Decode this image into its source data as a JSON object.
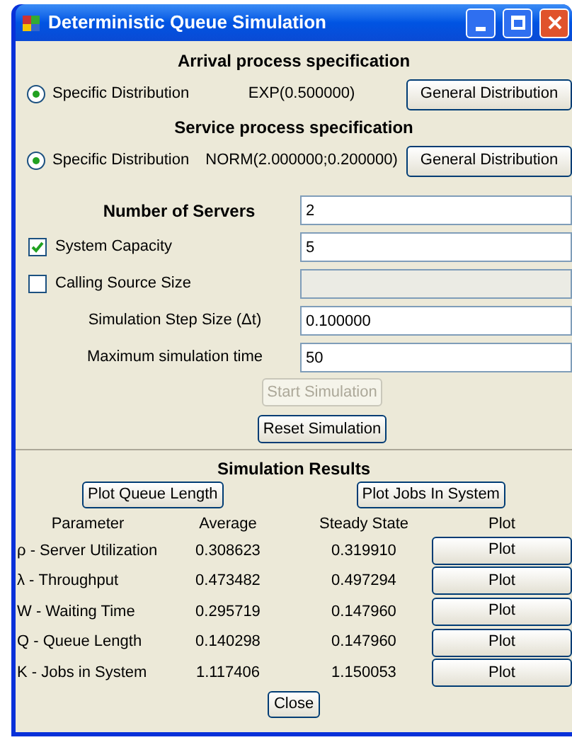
{
  "window": {
    "title": "Deterministic Queue Simulation"
  },
  "processes": [
    {
      "heading": "Arrival process specification",
      "radio": {
        "label": "Specific Distribution",
        "selected": true
      },
      "value": "EXP(0.500000)",
      "button": "General Distribution"
    },
    {
      "heading": "Service process specification",
      "radio": {
        "label": "Specific Distribution",
        "selected": true
      },
      "value": "NORM(2.000000;0.200000)",
      "button": "General Distribution"
    }
  ],
  "fields": [
    {
      "kind": "bold",
      "label": "Number of Servers",
      "value": "2",
      "disabled": false
    },
    {
      "kind": "checkbox",
      "label": "System Capacity",
      "checked": true,
      "value": "5",
      "disabled": false
    },
    {
      "kind": "checkbox",
      "label": "Calling Source Size",
      "checked": false,
      "disabled": true
    },
    {
      "kind": "plain",
      "label": "Simulation Step Size (Δt)",
      "value": "0.100000",
      "disabled": false
    },
    {
      "kind": "plain",
      "label": "Maximum simulation time",
      "value": "50",
      "disabled": false
    }
  ],
  "actions": [
    {
      "label": "Start Simulation",
      "disabled": true
    },
    {
      "label": "Reset Simulation",
      "disabled": false
    }
  ],
  "results": {
    "heading": "Simulation Results",
    "plot_buttons": [
      "Plot Queue Length",
      "Plot Jobs In System"
    ],
    "columns": [
      "Parameter",
      "Average",
      "Steady State",
      "Plot"
    ],
    "rows": [
      {
        "parameter": "ρ - Server Utilization",
        "average": "0.308623",
        "steady_state": "0.319910",
        "plot": "Plot"
      },
      {
        "parameter": "λ - Throughput",
        "average": "0.473482",
        "steady_state": "0.497294",
        "plot": "Plot"
      },
      {
        "parameter": "W - Waiting Time",
        "average": "0.295719",
        "steady_state": "0.147960",
        "plot": "Plot"
      },
      {
        "parameter": "Q - Queue Length",
        "average": "0.140298",
        "steady_state": "0.147960",
        "plot": "Plot"
      },
      {
        "parameter": "K - Jobs in System",
        "average": "1.117406",
        "steady_state": "1.150053",
        "plot": "Plot"
      }
    ]
  },
  "close": "Close"
}
